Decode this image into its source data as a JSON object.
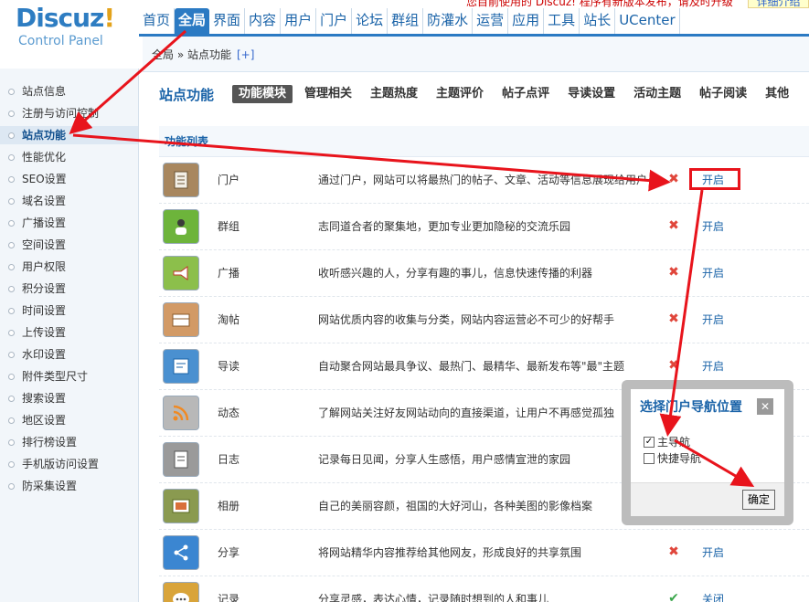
{
  "header": {
    "brand": "Discuz",
    "brand_bang": "!",
    "subtitle": "Control Panel",
    "notice": "您目前使用的 Discuz! 程序有新版本发布，请及时升级",
    "notice_link": "详细介绍",
    "nav": [
      "首页",
      "全局",
      "界面",
      "内容",
      "用户",
      "门户",
      "论坛",
      "群组",
      "防灌水",
      "运营",
      "应用",
      "工具",
      "站长",
      "UCenter"
    ]
  },
  "breadcrumb": {
    "path": "全局 » 站点功能",
    "plus": "[+]"
  },
  "sidebar": {
    "items": [
      "站点信息",
      "注册与访问控制",
      "站点功能",
      "性能优化",
      "SEO设置",
      "域名设置",
      "广播设置",
      "空间设置",
      "用户权限",
      "积分设置",
      "时间设置",
      "上传设置",
      "水印设置",
      "附件类型尺寸",
      "搜索设置",
      "地区设置",
      "排行榜设置",
      "手机版访问设置",
      "防采集设置"
    ]
  },
  "main": {
    "title": "站点功能",
    "tabs": [
      "功能模块",
      "管理相关",
      "主题热度",
      "主题评价",
      "帖子点评",
      "导读设置",
      "活动主题",
      "帖子阅读",
      "其他"
    ],
    "section": "功能列表",
    "rows": [
      {
        "name": "门户",
        "desc": "通过门户，网站可以将最热门的帖子、文章、活动等信息展现给用户",
        "status": "✖",
        "action": "开启",
        "icon": "portal-icon",
        "color": "#a8875f"
      },
      {
        "name": "群组",
        "desc": "志同道合者的聚集地，更加专业更加隐秘的交流乐园",
        "status": "✖",
        "action": "开启",
        "icon": "group-icon",
        "color": "#6db43b"
      },
      {
        "name": "广播",
        "desc": "收听感兴趣的人，分享有趣的事儿，信息快速传播的利器",
        "status": "✖",
        "action": "开启",
        "icon": "megaphone-icon",
        "color": "#8cbf4b"
      },
      {
        "name": "淘帖",
        "desc": "网站优质内容的收集与分类，网站内容运营必不可少的好帮手",
        "status": "✖",
        "action": "开启",
        "icon": "tray-icon",
        "color": "#d29a66"
      },
      {
        "name": "导读",
        "desc": "自动聚合网站最具争议、最热门、最精华、最新发布等\"最\"主题",
        "status": "✖",
        "action": "开启",
        "icon": "guide-icon",
        "color": "#4a90d0"
      },
      {
        "name": "动态",
        "desc": "了解网站关注好友网站动向的直接渠道，让用户不再感觉孤独",
        "status": "",
        "action": "",
        "icon": "rss-icon",
        "color": "#b8b8b8"
      },
      {
        "name": "日志",
        "desc": "记录每日见闻，分享人生感悟，用户感情宣泄的家园",
        "status": "",
        "action": "",
        "icon": "blog-icon",
        "color": "#9a9a9a"
      },
      {
        "name": "相册",
        "desc": "自己的美丽容颜，祖国的大好河山，各种美图的影像档案",
        "status": "",
        "action": "",
        "icon": "album-icon",
        "color": "#8a9a50"
      },
      {
        "name": "分享",
        "desc": "将网站精华内容推荐给其他网友，形成良好的共享氛围",
        "status": "✖",
        "action": "开启",
        "icon": "share-icon",
        "color": "#3b86d1"
      },
      {
        "name": "记录",
        "desc": "分享灵感，表达心情，记录随时想到的人和事儿",
        "status": "✔",
        "action": "关闭",
        "icon": "chat-icon",
        "color": "#d9a43a"
      }
    ]
  },
  "modal": {
    "title": "选择门户导航位置",
    "close": "✕",
    "options": [
      {
        "label": "主导航",
        "checked": "✓"
      },
      {
        "label": "快捷导航",
        "checked": ""
      }
    ],
    "confirm": "确定"
  }
}
